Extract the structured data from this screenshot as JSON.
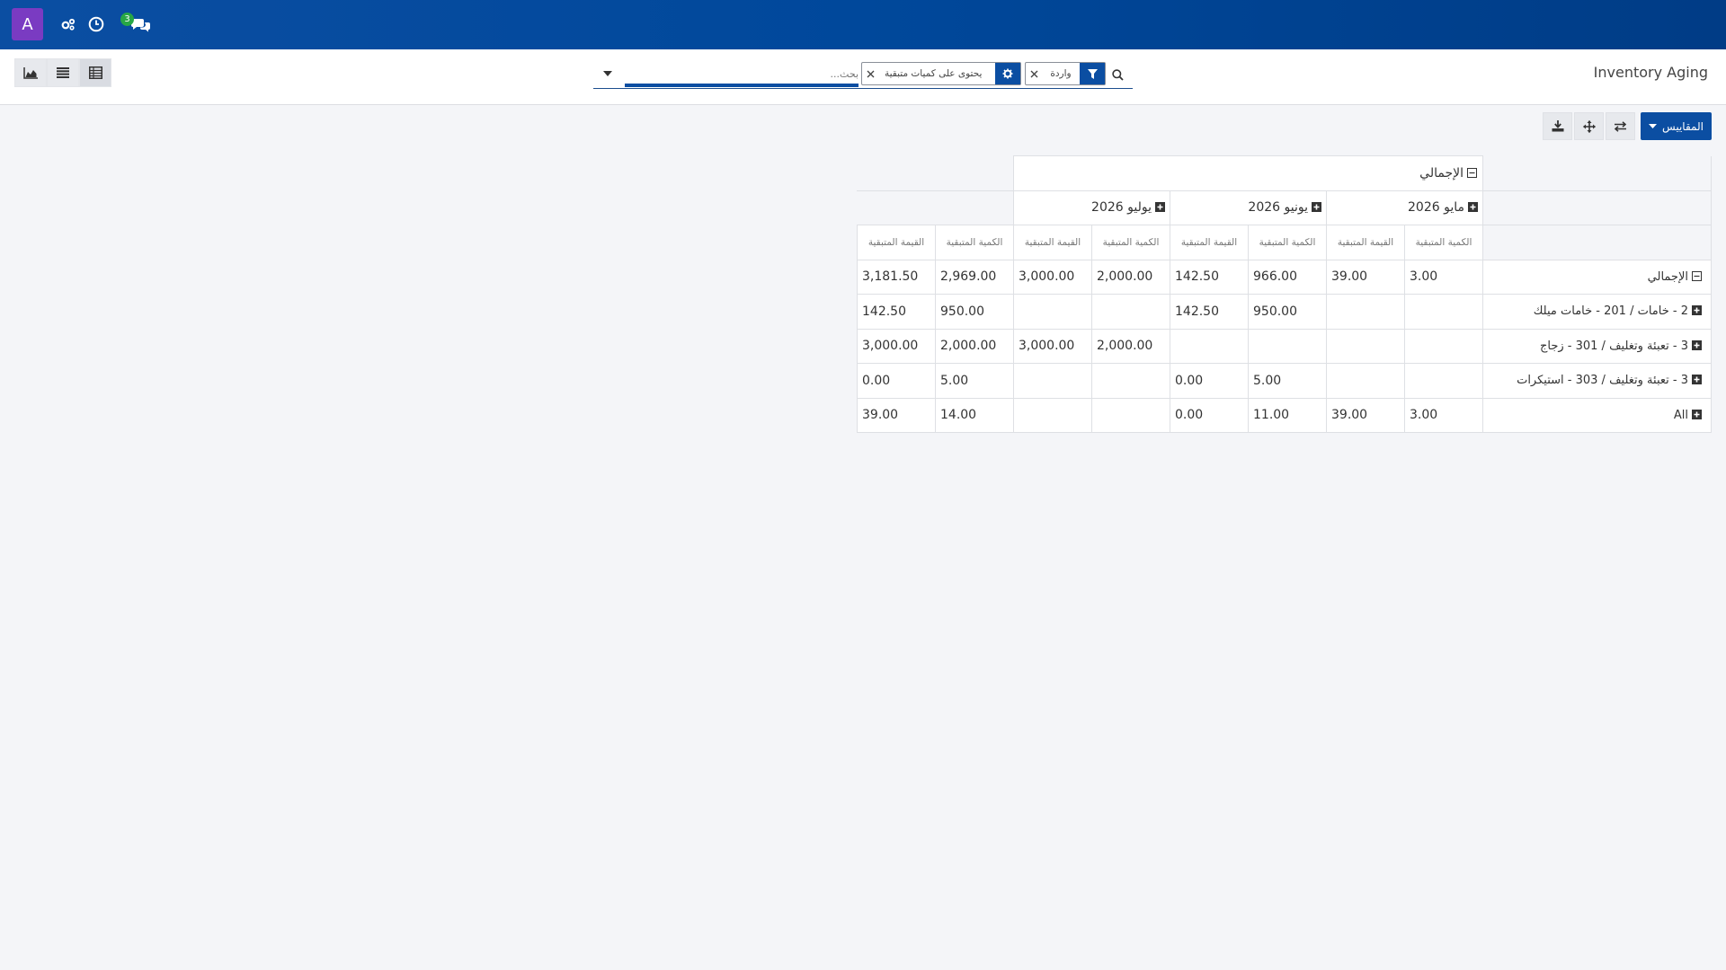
{
  "navbar": {
    "avatar_letter": "A",
    "chat_badge": "3"
  },
  "control_panel": {
    "title": "Inventory Aging",
    "search": {
      "placeholder": "بحث...",
      "filter_facet": "واردة",
      "groupby_facet": "يحتوى على كميات متبقية"
    }
  },
  "actions": {
    "measures_label": "المقاييس"
  },
  "pivot": {
    "total_header": "الإجمالي",
    "months": [
      "مايو 2026",
      "يونيو 2026",
      "يوليو 2026"
    ],
    "measures": [
      "الكمية المتبقية",
      "القيمة المتبقية",
      "الكمية المتبقية",
      "القيمة المتبقية",
      "الكمية المتبقية",
      "القيمة المتبقية",
      "الكمية المتبقية",
      "القيمة المتبقية"
    ],
    "rows": [
      {
        "label": "الإجمالي",
        "expanded": true,
        "values": [
          "3.00",
          "39.00",
          "966.00",
          "142.50",
          "2,000.00",
          "3,000.00",
          "2,969.00",
          "3,181.50"
        ]
      },
      {
        "label": "2 - خامات / 201 - خامات ميلك",
        "expanded": false,
        "values": [
          "",
          "",
          "950.00",
          "142.50",
          "",
          "",
          "950.00",
          "142.50"
        ]
      },
      {
        "label": "3 - تعبئة وتغليف / 301 - زجاج",
        "expanded": false,
        "values": [
          "",
          "",
          "",
          "",
          "2,000.00",
          "3,000.00",
          "2,000.00",
          "3,000.00"
        ]
      },
      {
        "label": "3 - تعبئة وتغليف / 303 - استيكرات",
        "expanded": false,
        "values": [
          "",
          "",
          "5.00",
          "0.00",
          "",
          "",
          "5.00",
          "0.00"
        ]
      },
      {
        "label": "All",
        "expanded": false,
        "values": [
          "3.00",
          "39.00",
          "11.00",
          "0.00",
          "",
          "",
          "14.00",
          "39.00"
        ]
      }
    ]
  }
}
